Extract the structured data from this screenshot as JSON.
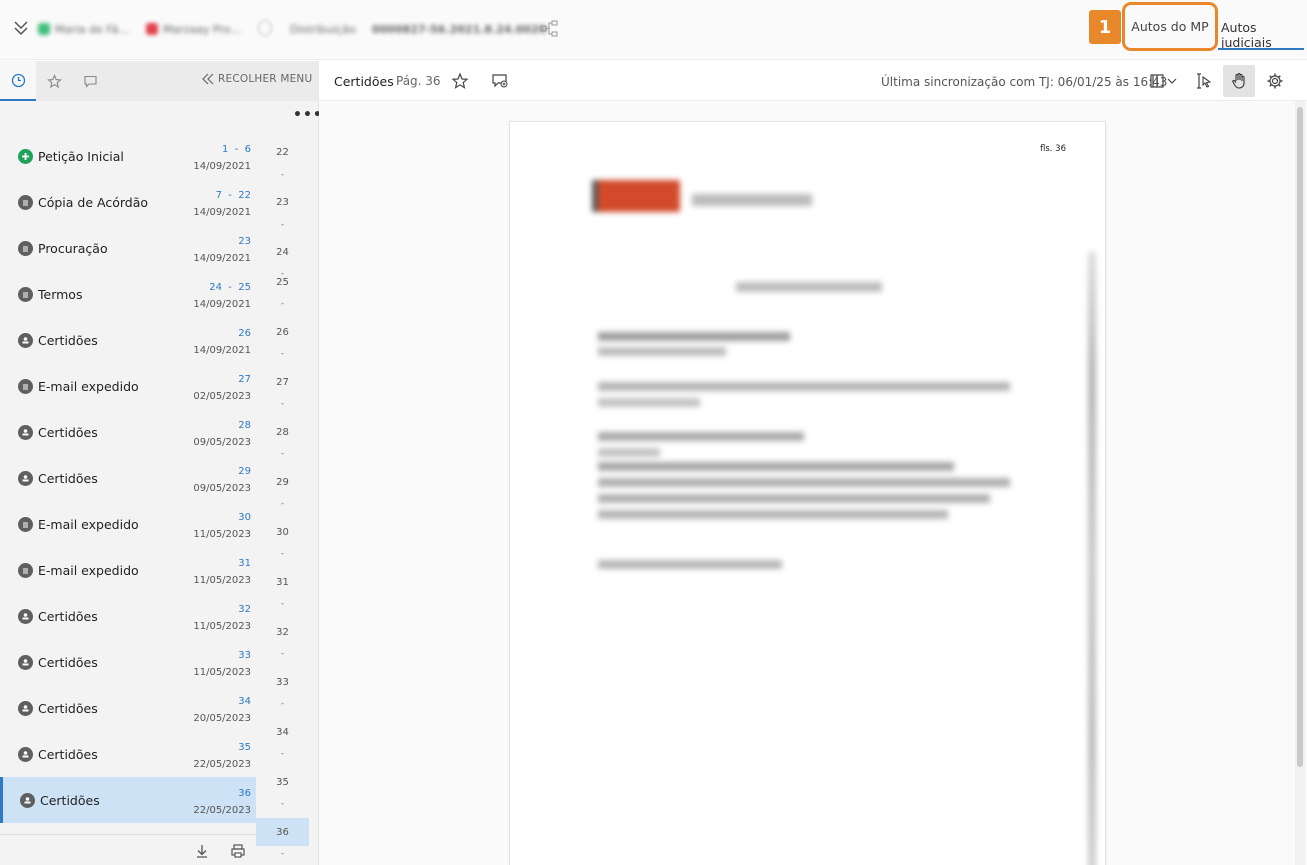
{
  "topbar": {
    "chips": [
      "Maria de Fá...",
      "Marzaay Pro...",
      "Distribuição",
      "0000827-56.2021.8.24.0020"
    ],
    "tabs": {
      "autos_mp": "Autos do MP",
      "autos_judiciais": "Autos judiciais"
    },
    "annotation_badge": "1",
    "accent_color": "#e8882b",
    "active_tab_color": "#2f79c4"
  },
  "sidebar": {
    "collapse_label": "RECOLHER MENU",
    "more_label": "•••",
    "documents": [
      {
        "label": "Petição Inicial",
        "pages": "1  -  6",
        "date": "14/09/2021",
        "icon": "plus-circle-icon"
      },
      {
        "label": "Cópia de Acórdão",
        "pages": "7  -  22",
        "date": "14/09/2021",
        "icon": "document-icon"
      },
      {
        "label": "Procuração",
        "pages": "23",
        "date": "14/09/2021",
        "icon": "document-icon"
      },
      {
        "label": "Termos",
        "pages": "24  -  25",
        "date": "14/09/2021",
        "icon": "document-icon"
      },
      {
        "label": "Certidões",
        "pages": "26",
        "date": "14/09/2021",
        "icon": "stamp-icon"
      },
      {
        "label": "E-mail expedido",
        "pages": "27",
        "date": "02/05/2023",
        "icon": "document-icon"
      },
      {
        "label": "Certidões",
        "pages": "28",
        "date": "09/05/2023",
        "icon": "stamp-icon"
      },
      {
        "label": "Certidões",
        "pages": "29",
        "date": "09/05/2023",
        "icon": "stamp-icon"
      },
      {
        "label": "E-mail expedido",
        "pages": "30",
        "date": "11/05/2023",
        "icon": "document-icon"
      },
      {
        "label": "E-mail expedido",
        "pages": "31",
        "date": "11/05/2023",
        "icon": "document-icon"
      },
      {
        "label": "Certidões",
        "pages": "32",
        "date": "11/05/2023",
        "icon": "stamp-icon"
      },
      {
        "label": "Certidões",
        "pages": "33",
        "date": "11/05/2023",
        "icon": "stamp-icon"
      },
      {
        "label": "Certidões",
        "pages": "34",
        "date": "20/05/2023",
        "icon": "stamp-icon"
      },
      {
        "label": "Certidões",
        "pages": "35",
        "date": "22/05/2023",
        "icon": "stamp-icon"
      },
      {
        "label": "Certidões",
        "pages": "36",
        "date": "22/05/2023",
        "icon": "stamp-icon",
        "selected": true
      }
    ],
    "page_column": [
      "22",
      "23",
      "24",
      "25",
      "26",
      "27",
      "28",
      "29",
      "30",
      "31",
      "32",
      "33",
      "34",
      "35",
      "36"
    ],
    "page_dash": "-"
  },
  "viewer": {
    "title": "Certidões",
    "page_label": "Pág. 36",
    "sync_text": "Última sincronização com TJ: 06/01/25 às 16:43",
    "page_stamp": "fls. 36"
  }
}
